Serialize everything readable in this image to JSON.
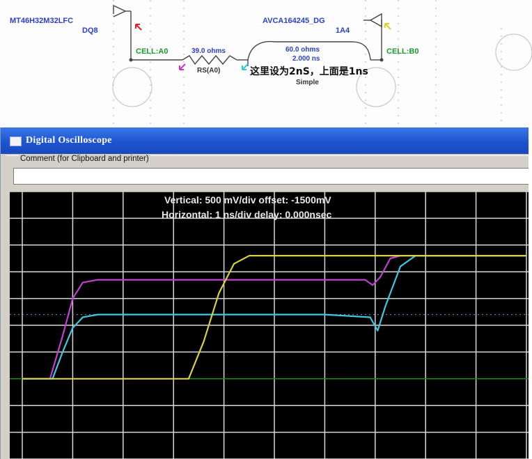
{
  "schematic": {
    "driver_part": "MT46H32M32LFC",
    "driver_pin": "DQ8",
    "receiver_part": "AVCA164245_DG",
    "receiver_pin": "1A4",
    "cell_left": "CELL:A0",
    "cell_right": "CELL:B0",
    "resistor_value": "39.0 ohms",
    "resistor_name": "RS(A0)",
    "tline_impedance": "60.0 ohms",
    "tline_delay": "2.000 ns",
    "tline_model": "Simple",
    "annotation": "这里设为2nS，上面是1ns",
    "colors": {
      "part_text": "#2a3fc8",
      "cell_text": "#1a9a2a"
    }
  },
  "window": {
    "title": "Digital Oscilloscope",
    "comment_label": "Comment (for Clipboard and printer)",
    "comment_value": ""
  },
  "scope": {
    "vertical_text": "Vertical: 500 mV/div  offset: -1500mV",
    "horizontal_text": "Horizontal: 1 ns/div  delay: 0.000nsec",
    "background": "#000000",
    "grid_color": "#d8d8d8",
    "reference_line_color": "#1a8a1a"
  },
  "chart_data": {
    "type": "line",
    "x_unit": "ns",
    "xlim": [
      0,
      10
    ],
    "y_unit": "mV",
    "ylim": [
      -1500,
      3500
    ],
    "series": [
      {
        "color": "#c040d0",
        "x": [
          0,
          0.55,
          0.8,
          1.0,
          1.2,
          1.5,
          2,
          4,
          6,
          6.8,
          6.95,
          7.1,
          7.3,
          7.5,
          10
        ],
        "y": [
          0,
          0,
          800,
          1500,
          1800,
          1850,
          1850,
          1850,
          1850,
          1850,
          1750,
          1900,
          2250,
          2300,
          2300
        ]
      },
      {
        "color": "#40c8e0",
        "x": [
          0,
          0.6,
          0.8,
          1.0,
          1.2,
          1.5,
          2,
          4,
          6,
          6.9,
          7.05,
          7.2,
          7.5,
          7.8,
          10
        ],
        "y": [
          0,
          0,
          500,
          950,
          1150,
          1200,
          1200,
          1200,
          1200,
          1150,
          900,
          1350,
          2100,
          2300,
          2300
        ]
      },
      {
        "color": "#d8d040",
        "x": [
          0,
          3.3,
          3.6,
          3.9,
          4.2,
          4.5,
          5,
          7,
          10
        ],
        "y": [
          0,
          0,
          700,
          1600,
          2150,
          2300,
          2300,
          2300,
          2300
        ]
      }
    ]
  }
}
